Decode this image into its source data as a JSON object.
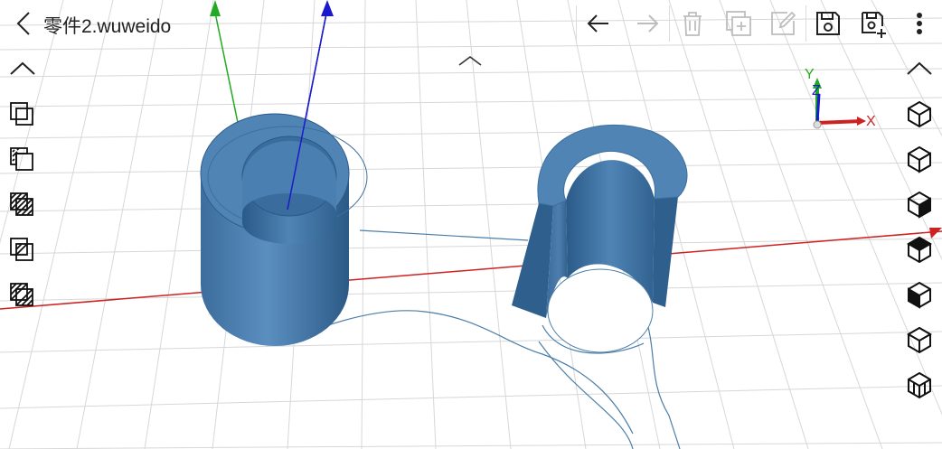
{
  "title": "零件2.wuweido",
  "toolbar": {
    "items": [
      {
        "name": "undo-button",
        "icon": "arrow-left-icon",
        "enabled": true
      },
      {
        "name": "redo-button",
        "icon": "arrow-right-icon",
        "enabled": false
      },
      {
        "name": "delete-button",
        "icon": "trash-icon",
        "enabled": false
      },
      {
        "name": "copy-button",
        "icon": "copy-plus-icon",
        "enabled": false
      },
      {
        "name": "edit-button",
        "icon": "edit-icon",
        "enabled": false
      },
      {
        "name": "save-button",
        "icon": "save-icon",
        "enabled": true
      },
      {
        "name": "save-as-button",
        "icon": "save-plus-icon",
        "enabled": true
      },
      {
        "name": "more-button",
        "icon": "more-vert-icon",
        "enabled": true
      }
    ]
  },
  "left_panel": {
    "items": [
      "collapse-up-icon",
      "union-icon",
      "subtract-icon",
      "intersect-icon",
      "split-icon",
      "combine-icon"
    ]
  },
  "right_panel": {
    "items": [
      "collapse-up-icon",
      "view-iso-icon",
      "view-front-icon",
      "view-right-icon",
      "view-left-icon",
      "view-back-icon",
      "view-bottom-icon",
      "view-top-icon"
    ]
  },
  "axes_indicator": {
    "x": "X",
    "y": "Y",
    "z": "Z"
  },
  "colors": {
    "model": "#4f84b5",
    "model_dark": "#2f5f8c",
    "x_axis": "#cc2222",
    "y_axis": "#22aa22",
    "z_axis": "#1a1acc",
    "grid": "#d7d7d7"
  }
}
